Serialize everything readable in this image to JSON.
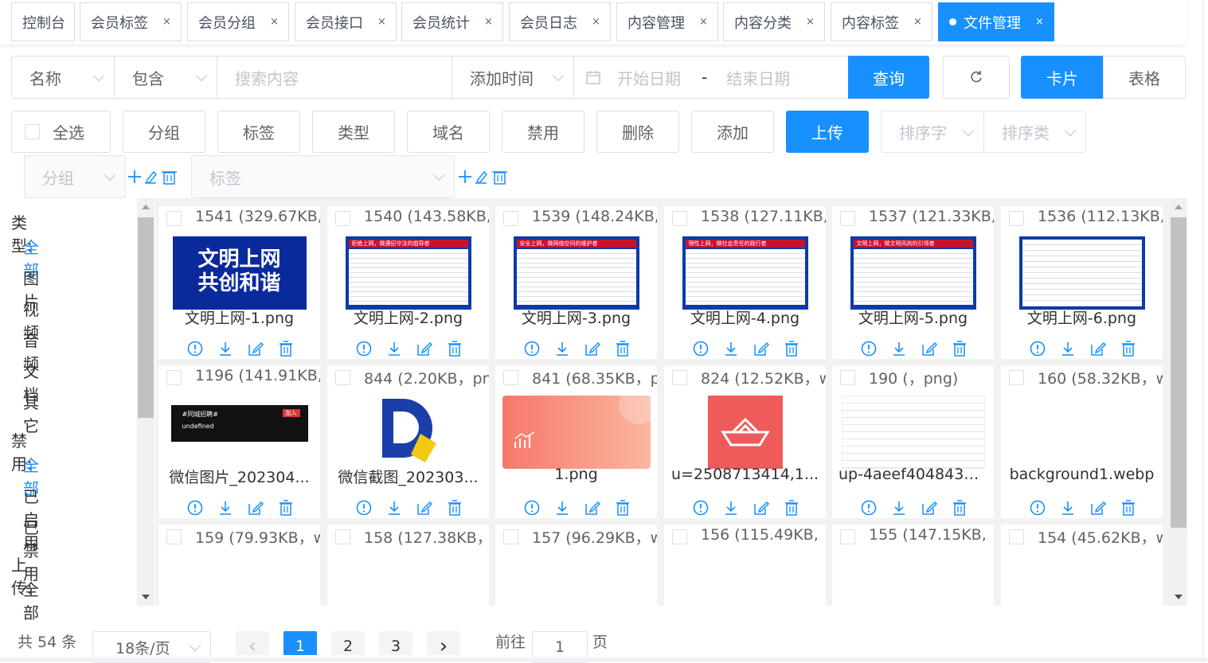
{
  "tabs": [
    {
      "label": "控制台",
      "closable": false
    },
    {
      "label": "会员标签",
      "closable": true
    },
    {
      "label": "会员分组",
      "closable": true
    },
    {
      "label": "会员接口",
      "closable": true
    },
    {
      "label": "会员统计",
      "closable": true
    },
    {
      "label": "会员日志",
      "closable": true
    },
    {
      "label": "内容管理",
      "closable": true
    },
    {
      "label": "内容分类",
      "closable": true
    },
    {
      "label": "内容标签",
      "closable": true
    },
    {
      "label": "文件管理",
      "closable": true,
      "active": true
    }
  ],
  "close_glyph": "×",
  "search": {
    "field": "名称",
    "op": "包含",
    "placeholder": "搜索内容",
    "time_field": "添加时间",
    "start_placeholder": "开始日期",
    "sep": "-",
    "end_placeholder": "结束日期",
    "query": "查询",
    "view_card": "卡片",
    "view_table": "表格"
  },
  "toolbar": {
    "select_all": "全选",
    "buttons": [
      "分组",
      "标签",
      "类型",
      "域名",
      "禁用",
      "删除",
      "添加"
    ],
    "upload": "上传",
    "sort_field": "排序字",
    "sort_type": "排序类"
  },
  "filters": {
    "group_placeholder": "分组",
    "tag_placeholder": "标签"
  },
  "sidebar": {
    "type_heading": "类型:",
    "types": [
      "全部",
      "图片",
      "视频",
      "音频",
      "文档",
      "其它"
    ],
    "ban_heading": "禁用:",
    "bans": [
      "全部",
      "已启用",
      "已禁用"
    ],
    "upload_heading": "上传:",
    "uploads": [
      "全部"
    ]
  },
  "cards": [
    {
      "title": "1541 (329.67KB,",
      "name": "文明上网-1.png"
    },
    {
      "title": "1540 (143.58KB,",
      "name": "文明上网-2.png"
    },
    {
      "title": "1539 (148.24KB,",
      "name": "文明上网-3.png"
    },
    {
      "title": "1538 (127.11KB,",
      "name": "文明上网-4.png"
    },
    {
      "title": "1537 (121.33KB,",
      "name": "文明上网-5.png"
    },
    {
      "title": "1536 (112.13KB,",
      "name": "文明上网-6.png"
    },
    {
      "title": "1196 (141.91KB,",
      "name": "微信图片_202304..."
    },
    {
      "title": "844 (2.20KB，pn",
      "name": "微信截图_202303..."
    },
    {
      "title": "841 (68.35KB，p",
      "name": "1.png"
    },
    {
      "title": "824 (12.52KB，w",
      "name": "u=2508713414,1..."
    },
    {
      "title": "190 (，png)",
      "name": "up-4aeef4048430..."
    },
    {
      "title": "160 (58.32KB，w",
      "name": "background1.webp"
    },
    {
      "title": "159 (79.93KB，w",
      "name": ""
    },
    {
      "title": "158 (127.38KB，",
      "name": ""
    },
    {
      "title": "157 (96.29KB，w",
      "name": ""
    },
    {
      "title": "156 (115.49KB,",
      "name": ""
    },
    {
      "title": "155 (147.15KB,",
      "name": ""
    },
    {
      "title": "154 (45.62KB，w",
      "name": ""
    }
  ],
  "thumb_text": {
    "t1_line1": "文明上网",
    "t1_line2": "共创和谐",
    "t2_head": "拒绝上网，做遵纪守法的倡导者",
    "t3_head": "安全上网，做网络空间的维护者",
    "t4_head": "理性上网，做社会责任的践行者",
    "t5_head": "文明上网，做文明风尚的引领者",
    "t7_line1": "#同城招聘#",
    "t7_tag": "加入",
    "t7_line2": "undefined"
  },
  "pagination": {
    "total": "共 54 条",
    "page_size": "18条/页",
    "pages": [
      "1",
      "2",
      "3"
    ],
    "current": "1",
    "goto_label": "前往",
    "goto_value": "1",
    "page_unit": "页",
    "prev": "‹",
    "next": "›"
  },
  "colors": {
    "primary": "#1890ff",
    "border": "#dcdfe6"
  }
}
